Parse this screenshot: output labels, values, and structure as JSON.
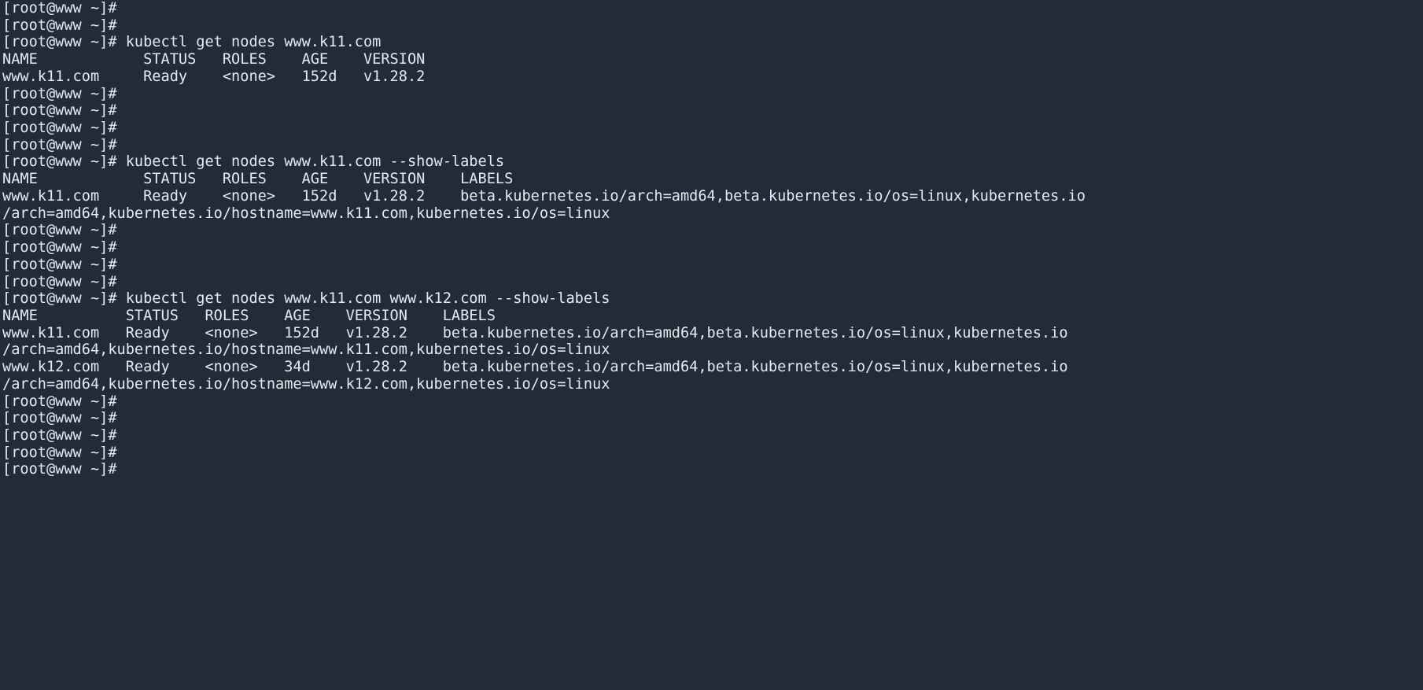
{
  "terminal": {
    "app_name": "terminal",
    "background_color": "#222b38",
    "foreground_color": "#dfe3ea",
    "prompt": "[root@www ~]#",
    "hostname": "www",
    "user": "root",
    "cwd": "~",
    "columns": 149,
    "rows": 40
  },
  "commands": {
    "cmd1": "kubectl get nodes www.k11.com",
    "cmd2": "kubectl get nodes www.k11.com --show-labels",
    "cmd3": "kubectl get nodes www.k11.com www.k12.com --show-labels"
  },
  "tables": {
    "table1": {
      "header": "NAME            STATUS   ROLES    AGE    VERSION",
      "rows": [
        "www.k11.com     Ready    <none>   152d   v1.28.2"
      ],
      "columns": [
        "NAME",
        "STATUS",
        "ROLES",
        "AGE",
        "VERSION"
      ],
      "values": [
        {
          "name": "www.k11.com",
          "status": "Ready",
          "roles": "<none>",
          "age": "152d",
          "version": "v1.28.2"
        }
      ]
    },
    "table2": {
      "header": "NAME            STATUS   ROLES    AGE    VERSION    LABELS",
      "rows": [
        "www.k11.com     Ready    <none>   152d   v1.28.2    beta.kubernetes.io/arch=amd64,beta.kubernetes.io/os=linux,kubernetes.io",
        "/arch=amd64,kubernetes.io/hostname=www.k11.com,kubernetes.io/os=linux"
      ],
      "columns": [
        "NAME",
        "STATUS",
        "ROLES",
        "AGE",
        "VERSION",
        "LABELS"
      ],
      "values": [
        {
          "name": "www.k11.com",
          "status": "Ready",
          "roles": "<none>",
          "age": "152d",
          "version": "v1.28.2",
          "labels": "beta.kubernetes.io/arch=amd64,beta.kubernetes.io/os=linux,kubernetes.io/arch=amd64,kubernetes.io/hostname=www.k11.com,kubernetes.io/os=linux"
        }
      ]
    },
    "table3": {
      "header": "NAME          STATUS   ROLES    AGE    VERSION    LABELS",
      "rows": [
        "www.k11.com   Ready    <none>   152d   v1.28.2    beta.kubernetes.io/arch=amd64,beta.kubernetes.io/os=linux,kubernetes.io",
        "/arch=amd64,kubernetes.io/hostname=www.k11.com,kubernetes.io/os=linux",
        "www.k12.com   Ready    <none>   34d    v1.28.2    beta.kubernetes.io/arch=amd64,beta.kubernetes.io/os=linux,kubernetes.io",
        "/arch=amd64,kubernetes.io/hostname=www.k12.com,kubernetes.io/os=linux"
      ],
      "columns": [
        "NAME",
        "STATUS",
        "ROLES",
        "AGE",
        "VERSION",
        "LABELS"
      ],
      "values": [
        {
          "name": "www.k11.com",
          "status": "Ready",
          "roles": "<none>",
          "age": "152d",
          "version": "v1.28.2",
          "labels": "beta.kubernetes.io/arch=amd64,beta.kubernetes.io/os=linux,kubernetes.io/arch=amd64,kubernetes.io/hostname=www.k11.com,kubernetes.io/os=linux"
        },
        {
          "name": "www.k12.com",
          "status": "Ready",
          "roles": "<none>",
          "age": "34d",
          "version": "v1.28.2",
          "labels": "beta.kubernetes.io/arch=amd64,beta.kubernetes.io/os=linux,kubernetes.io/arch=amd64,kubernetes.io/hostname=www.k12.com,kubernetes.io/os=linux"
        }
      ]
    }
  },
  "lines": [
    "[root@www ~]#",
    "[root@www ~]#",
    "[root@www ~]# kubectl get nodes www.k11.com",
    "NAME            STATUS   ROLES    AGE    VERSION",
    "www.k11.com     Ready    <none>   152d   v1.28.2",
    "[root@www ~]#",
    "[root@www ~]#",
    "[root@www ~]#",
    "[root@www ~]#",
    "[root@www ~]# kubectl get nodes www.k11.com --show-labels",
    "NAME            STATUS   ROLES    AGE    VERSION    LABELS",
    "www.k11.com     Ready    <none>   152d   v1.28.2    beta.kubernetes.io/arch=amd64,beta.kubernetes.io/os=linux,kubernetes.io",
    "/arch=amd64,kubernetes.io/hostname=www.k11.com,kubernetes.io/os=linux",
    "[root@www ~]#",
    "[root@www ~]#",
    "[root@www ~]#",
    "[root@www ~]#",
    "[root@www ~]# kubectl get nodes www.k11.com www.k12.com --show-labels",
    "NAME          STATUS   ROLES    AGE    VERSION    LABELS",
    "www.k11.com   Ready    <none>   152d   v1.28.2    beta.kubernetes.io/arch=amd64,beta.kubernetes.io/os=linux,kubernetes.io",
    "/arch=amd64,kubernetes.io/hostname=www.k11.com,kubernetes.io/os=linux",
    "www.k12.com   Ready    <none>   34d    v1.28.2    beta.kubernetes.io/arch=amd64,beta.kubernetes.io/os=linux,kubernetes.io",
    "/arch=amd64,kubernetes.io/hostname=www.k12.com,kubernetes.io/os=linux",
    "[root@www ~]#",
    "[root@www ~]#",
    "[root@www ~]#",
    "[root@www ~]#",
    "[root@www ~]#"
  ]
}
